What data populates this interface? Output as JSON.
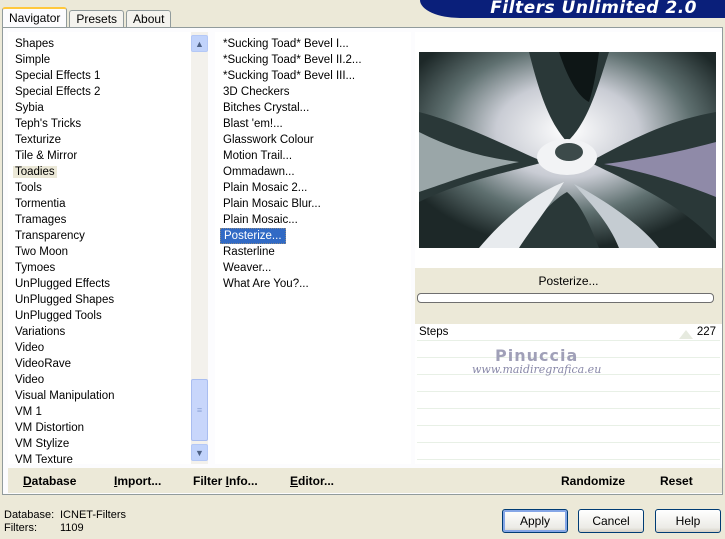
{
  "app": {
    "banner_title": "Filters Unlimited 2.0"
  },
  "tabs": [
    {
      "label": "Navigator",
      "active": true
    },
    {
      "label": "Presets",
      "active": false
    },
    {
      "label": "About",
      "active": false
    }
  ],
  "categories": [
    "Shapes",
    "Simple",
    "Special Effects 1",
    "Special Effects 2",
    "Sybia",
    "Teph's Tricks",
    "Texturize",
    "Tile & Mirror",
    "Toadies",
    "Tools",
    "Tormentia",
    "Tramages",
    "Transparency",
    "Two Moon",
    "Tymoes",
    "UnPlugged Effects",
    "UnPlugged Shapes",
    "UnPlugged Tools",
    "Variations",
    "Video",
    "VideoRave",
    "Video",
    "Visual Manipulation",
    "VM 1",
    "VM Distortion",
    "VM Stylize",
    "VM Texture"
  ],
  "selected_category": "Toadies",
  "filters": [
    "*Sucking Toad*  Bevel I...",
    "*Sucking Toad*  Bevel II.2...",
    "*Sucking Toad*  Bevel III...",
    "3D Checkers",
    "Bitches Crystal...",
    "Blast 'em!...",
    "Glasswork Colour",
    "Motion Trail...",
    "Ommadawn...",
    "Plain Mosaic 2...",
    "Plain Mosaic Blur...",
    "Plain Mosaic...",
    "Posterize...",
    "Rasterline",
    "Weaver...",
    "What Are You?..."
  ],
  "selected_filter": "Posterize...",
  "preview": {
    "filter_name": "Posterize...",
    "params": [
      {
        "label": "Steps",
        "value": "227"
      }
    ],
    "watermark_name": "Pinuccia",
    "watermark_url": "www.maidiregrafica.eu"
  },
  "bottom_links": {
    "database": {
      "pre": "",
      "u": "D",
      "post": "atabase"
    },
    "import": {
      "pre": "",
      "u": "I",
      "post": "mport..."
    },
    "filter_info": {
      "pre": "Filter ",
      "u": "I",
      "post": "nfo..."
    },
    "editor": {
      "pre": "",
      "u": "E",
      "post": "ditor..."
    },
    "randomize": "Randomize",
    "reset": "Reset"
  },
  "status": {
    "database_label": "Database:",
    "database_value": "ICNET-Filters",
    "filters_label": "Filters:",
    "filters_value": "1109"
  },
  "buttons": {
    "apply": "Apply",
    "cancel": "Cancel",
    "help": "Help"
  },
  "colors": {
    "banner": "#0a1f7a",
    "selection": "#316ac5",
    "window_bg": "#ece9d8"
  }
}
